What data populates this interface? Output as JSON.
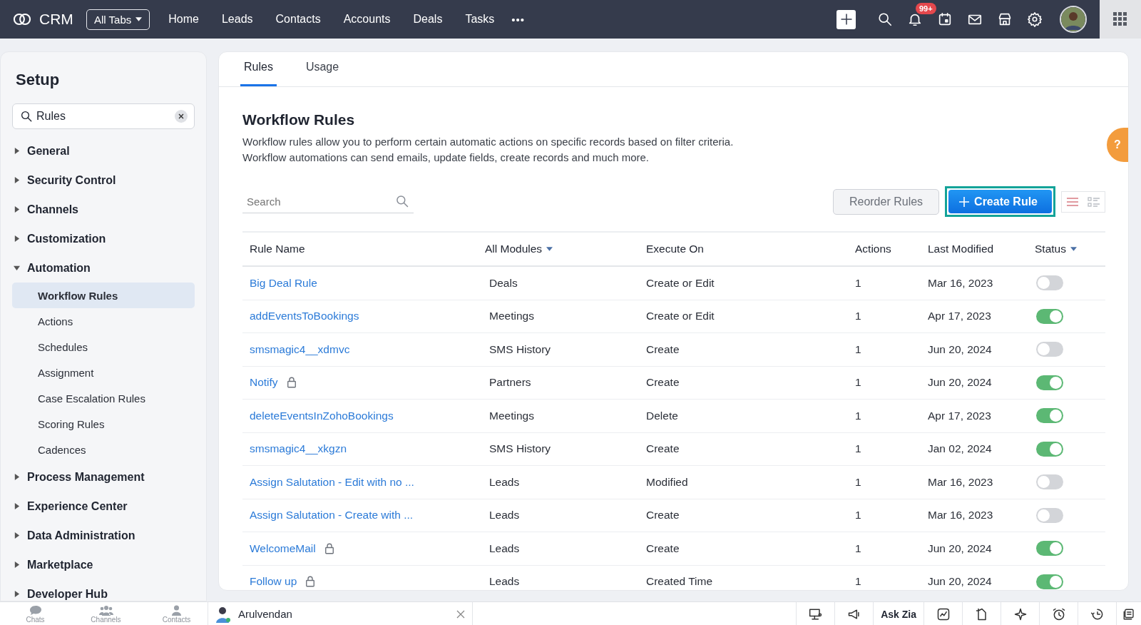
{
  "app": {
    "name": "CRM"
  },
  "top_nav": {
    "tabs_menu": "All Tabs",
    "items": [
      "Home",
      "Leads",
      "Contacts",
      "Accounts",
      "Deals",
      "Tasks"
    ],
    "more": "•••",
    "notification_count": "99+"
  },
  "sidebar": {
    "title": "Setup",
    "search": {
      "value": "Rules"
    },
    "sections": [
      {
        "label": "General",
        "expanded": false
      },
      {
        "label": "Security Control",
        "expanded": false
      },
      {
        "label": "Channels",
        "expanded": false
      },
      {
        "label": "Customization",
        "expanded": false
      },
      {
        "label": "Automation",
        "expanded": true,
        "children": [
          {
            "label": "Workflow Rules",
            "selected": true
          },
          {
            "label": "Actions",
            "selected": false
          },
          {
            "label": "Schedules",
            "selected": false
          },
          {
            "label": "Assignment",
            "selected": false
          },
          {
            "label": "Case Escalation Rules",
            "selected": false
          },
          {
            "label": "Scoring Rules",
            "selected": false
          },
          {
            "label": "Cadences",
            "selected": false
          }
        ]
      },
      {
        "label": "Process Management",
        "expanded": false
      },
      {
        "label": "Experience Center",
        "expanded": false
      },
      {
        "label": "Data Administration",
        "expanded": false
      },
      {
        "label": "Marketplace",
        "expanded": false
      },
      {
        "label": "Developer Hub",
        "expanded": false
      }
    ]
  },
  "tabs": [
    {
      "label": "Rules",
      "selected": true
    },
    {
      "label": "Usage",
      "selected": false
    }
  ],
  "page": {
    "title": "Workflow Rules",
    "description": [
      "Workflow rules allow you to perform certain automatic actions on specific records based on filter criteria.",
      "Workflow automations can send emails, update fields, create records and much more."
    ],
    "help_tab": "?"
  },
  "toolbar": {
    "search": {
      "placeholder": "Search"
    },
    "reorder_button": "Reorder Rules",
    "create_button": "Create Rule",
    "views": [
      {
        "kind": "list",
        "selected": true
      },
      {
        "kind": "detail",
        "selected": false
      }
    ]
  },
  "table": {
    "columns": [
      {
        "label": "Rule Name",
        "dropdown": false
      },
      {
        "label": "All Modules",
        "dropdown": true
      },
      {
        "label": "Execute On",
        "dropdown": false
      },
      {
        "label": "Actions",
        "dropdown": false
      },
      {
        "label": "Last Modified",
        "dropdown": false
      },
      {
        "label": "Status",
        "dropdown": true
      }
    ],
    "rows": [
      {
        "name": "Big Deal Rule",
        "locked": false,
        "module": "Deals",
        "execute_on": "Create or Edit",
        "actions": "1",
        "last_modified": "Mar 16, 2023",
        "on": false
      },
      {
        "name": "addEventsToBookings",
        "locked": false,
        "module": "Meetings",
        "execute_on": "Create or Edit",
        "actions": "1",
        "last_modified": "Apr 17, 2023",
        "on": true
      },
      {
        "name": "smsmagic4__xdmvc",
        "locked": false,
        "module": "SMS History",
        "execute_on": "Create",
        "actions": "1",
        "last_modified": "Jun 20, 2024",
        "on": false
      },
      {
        "name": "Notify",
        "locked": true,
        "module": "Partners",
        "execute_on": "Create",
        "actions": "1",
        "last_modified": "Jun 20, 2024",
        "on": true
      },
      {
        "name": "deleteEventsInZohoBookings",
        "locked": false,
        "module": "Meetings",
        "execute_on": "Delete",
        "actions": "1",
        "last_modified": "Apr 17, 2023",
        "on": true
      },
      {
        "name": "smsmagic4__xkgzn",
        "locked": false,
        "module": "SMS History",
        "execute_on": "Create",
        "actions": "1",
        "last_modified": "Jan 02, 2024",
        "on": true
      },
      {
        "name": "Assign Salutation - Edit with no ...",
        "locked": false,
        "module": "Leads",
        "execute_on": "Modified",
        "actions": "1",
        "last_modified": "Mar 16, 2023",
        "on": false
      },
      {
        "name": "Assign Salutation - Create with ...",
        "locked": false,
        "module": "Leads",
        "execute_on": "Create",
        "actions": "1",
        "last_modified": "Mar 16, 2023",
        "on": false
      },
      {
        "name": "WelcomeMail",
        "locked": true,
        "module": "Leads",
        "execute_on": "Create",
        "actions": "1",
        "last_modified": "Jun 20, 2024",
        "on": true
      },
      {
        "name": "Follow up",
        "locked": true,
        "module": "Leads",
        "execute_on": "Created Time",
        "actions": "1",
        "last_modified": "Jun 20, 2024",
        "on": true
      }
    ]
  },
  "bottom_bar": {
    "dock": [
      {
        "kind": "chats",
        "label": "Chats"
      },
      {
        "kind": "channels",
        "label": "Channels"
      },
      {
        "kind": "contacts",
        "label": "Contacts"
      }
    ],
    "chat_tab": {
      "name": "Arulvendan"
    },
    "ask_zia": "Ask Zia"
  }
}
